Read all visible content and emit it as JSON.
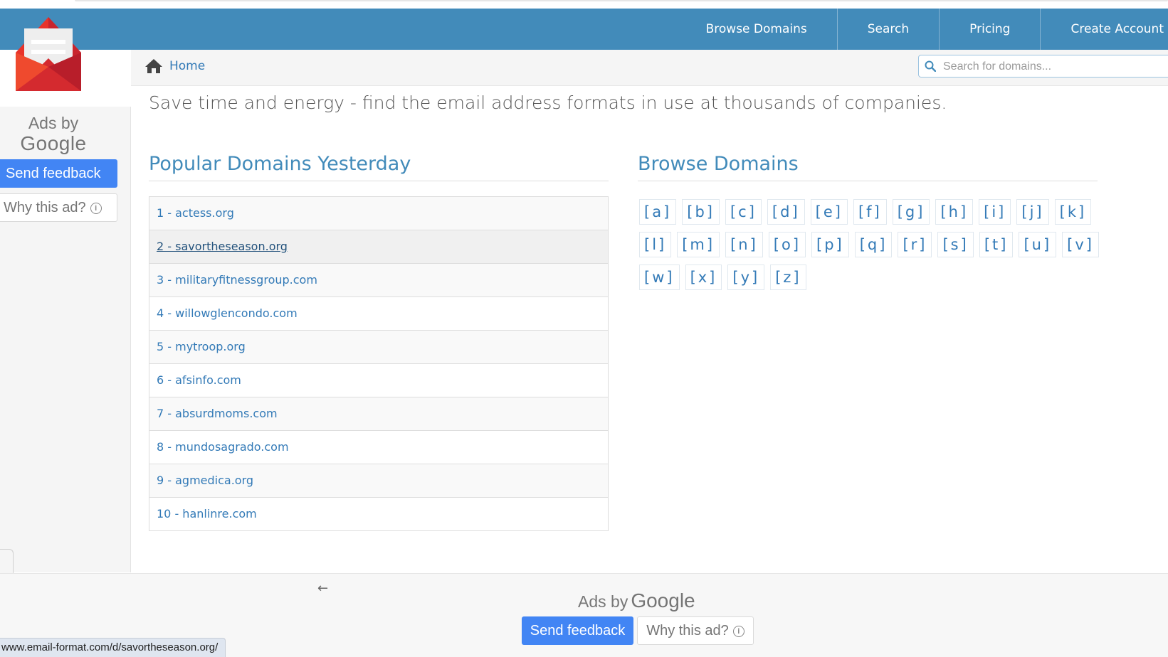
{
  "navbar": {
    "items": [
      {
        "label": "Browse Domains"
      },
      {
        "label": "Search"
      },
      {
        "label": "Pricing"
      },
      {
        "label": "Create Account"
      }
    ]
  },
  "breadcrumb": {
    "home_label": "Home"
  },
  "search": {
    "placeholder": "Search for domains..."
  },
  "tagline": "Save time and energy - find the email address formats in use at thousands of companies.",
  "popular": {
    "title": "Popular Domains Yesterday",
    "items": [
      "1 - actess.org",
      "2 - savortheseason.org",
      "3 - militaryfitnessgroup.com",
      "4 - willowglencondo.com",
      "5 - mytroop.org",
      "6 - afsinfo.com",
      "7 - absurdmoms.com",
      "8 - mundosagrado.com",
      "9 - agmedica.org",
      "10 - hanlinre.com"
    ]
  },
  "browse": {
    "title": "Browse Domains",
    "letters": [
      "[a]",
      "[b]",
      "[c]",
      "[d]",
      "[e]",
      "[f]",
      "[g]",
      "[h]",
      "[i]",
      "[j]",
      "[k]",
      "[l]",
      "[m]",
      "[n]",
      "[o]",
      "[p]",
      "[q]",
      "[r]",
      "[s]",
      "[t]",
      "[u]",
      "[v]",
      "[w]",
      "[x]",
      "[y]",
      "[z]"
    ]
  },
  "side_ad": {
    "ads_by": "Ads by",
    "google": "Google",
    "send_feedback": "Send feedback",
    "why_this_ad": "Why this ad?"
  },
  "bottom_ad": {
    "ads_by": "Ads by",
    "google": "Google",
    "send_feedback": "Send feedback",
    "why_this_ad": "Why this ad?",
    "back_arrow": "←"
  },
  "status_bar": {
    "url": "www.email-format.com/d/savortheseason.org/"
  },
  "colors": {
    "navbar": "#428bba",
    "link": "#337ab7",
    "ad_button": "#4285f4",
    "logo_red": "#e8332a"
  }
}
